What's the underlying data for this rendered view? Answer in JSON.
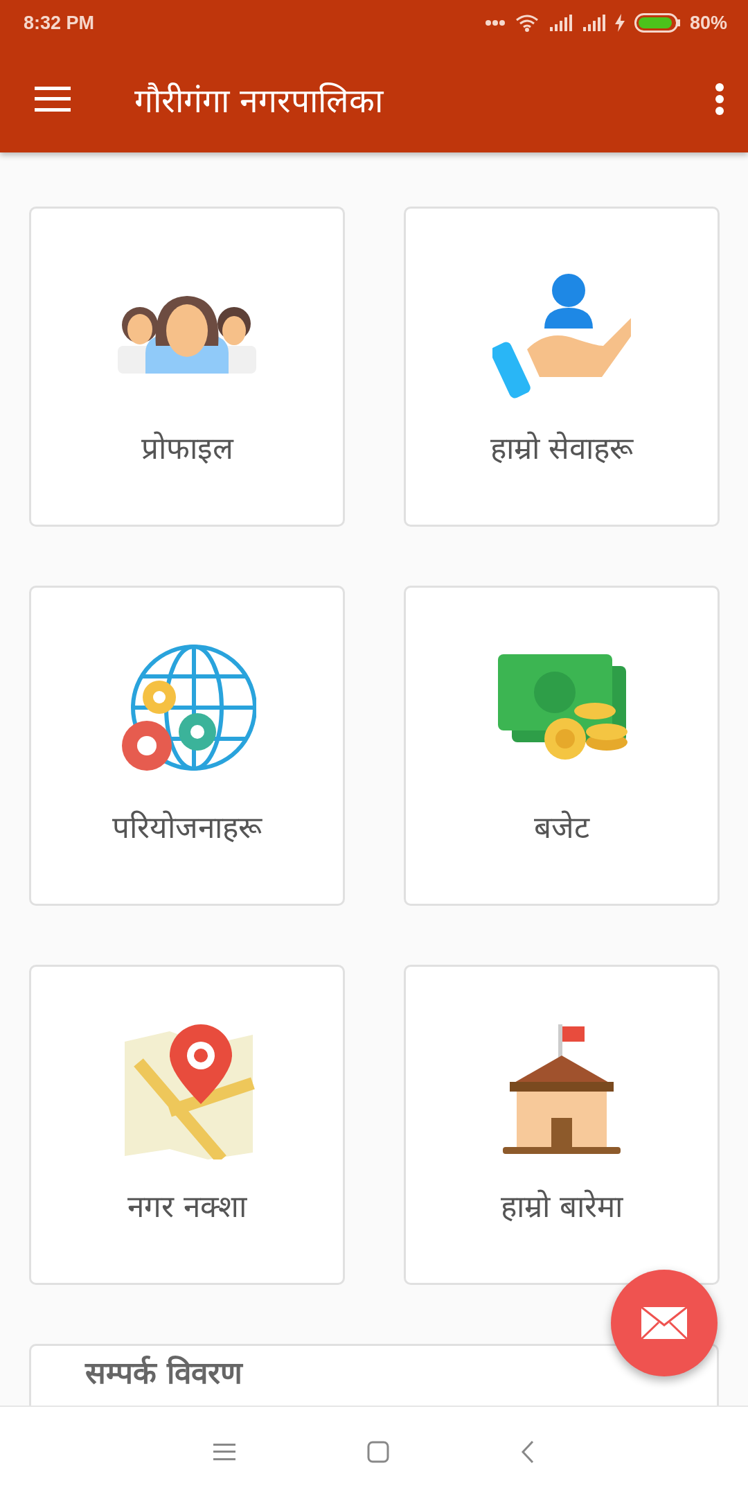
{
  "status_bar": {
    "time": "8:32 PM",
    "battery": "80%"
  },
  "app_bar": {
    "title": "गौरीगंगा नगरपालिका"
  },
  "tiles": [
    {
      "kind": "people",
      "label": "प्रोफाइल"
    },
    {
      "kind": "service",
      "label": "हाम्रो सेवाहरू"
    },
    {
      "kind": "globe",
      "label": "परियोजनाहरू"
    },
    {
      "kind": "money",
      "label": "बजेट"
    },
    {
      "kind": "map",
      "label": "नगर नक्शा"
    },
    {
      "kind": "building",
      "label": "हाम्रो बारेमा"
    }
  ],
  "contact_card": {
    "heading": "सम्पर्क विवरण"
  }
}
